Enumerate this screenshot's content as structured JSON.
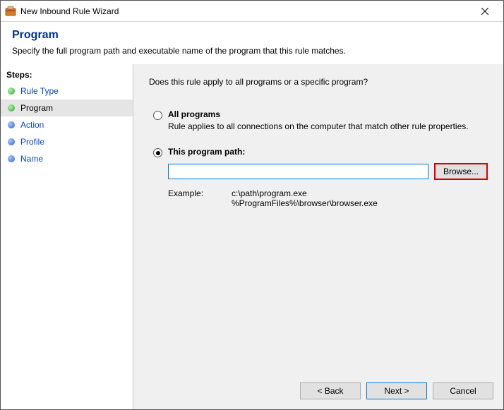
{
  "window": {
    "title": "New Inbound Rule Wizard"
  },
  "header": {
    "title": "Program",
    "description": "Specify the full program path and executable name of the program that this rule matches."
  },
  "sidebar": {
    "steps_label": "Steps:",
    "items": [
      {
        "label": "Rule Type"
      },
      {
        "label": "Program"
      },
      {
        "label": "Action"
      },
      {
        "label": "Profile"
      },
      {
        "label": "Name"
      }
    ]
  },
  "content": {
    "question": "Does this rule apply to all programs or a specific program?",
    "option_all": {
      "label": "All programs",
      "desc": "Rule applies to all connections on the computer that match other rule properties."
    },
    "option_path": {
      "label": "This program path:",
      "value": "",
      "browse": "Browse...",
      "example_label": "Example:",
      "example_values": "c:\\path\\program.exe\n%ProgramFiles%\\browser\\browser.exe"
    }
  },
  "footer": {
    "back": "< Back",
    "next": "Next >",
    "cancel": "Cancel"
  }
}
